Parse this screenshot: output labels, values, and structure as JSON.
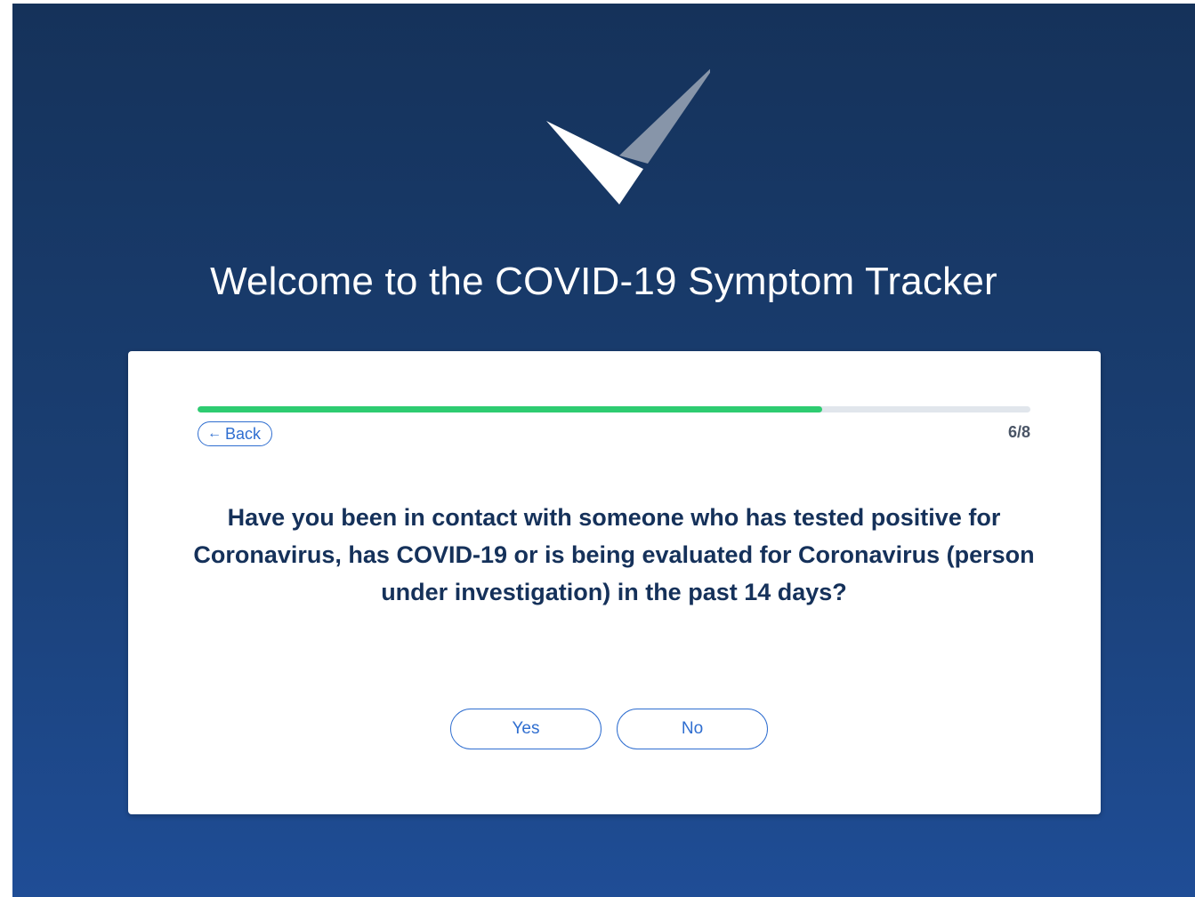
{
  "header": {
    "title": "Welcome to the COVID-19 Symptom Tracker"
  },
  "progress": {
    "fraction": 0.75,
    "step_label": "6/8",
    "fill_color": "#2ecc71"
  },
  "navigation": {
    "back_arrow": "←",
    "back_label": "Back"
  },
  "question": {
    "text": "Have you been in contact with someone who has tested positive for Coronavirus, has COVID-19 or is being evaluated for Coronavirus (person under investigation) in the past 14 days?"
  },
  "answers": {
    "yes_label": "Yes",
    "no_label": "No"
  },
  "colors": {
    "accent": "#2f6ed0",
    "background_top": "#15325a",
    "background_bottom": "#1f4d96",
    "question_text": "#15315a"
  },
  "icons": {
    "logo": "checkmark-logo-icon"
  }
}
